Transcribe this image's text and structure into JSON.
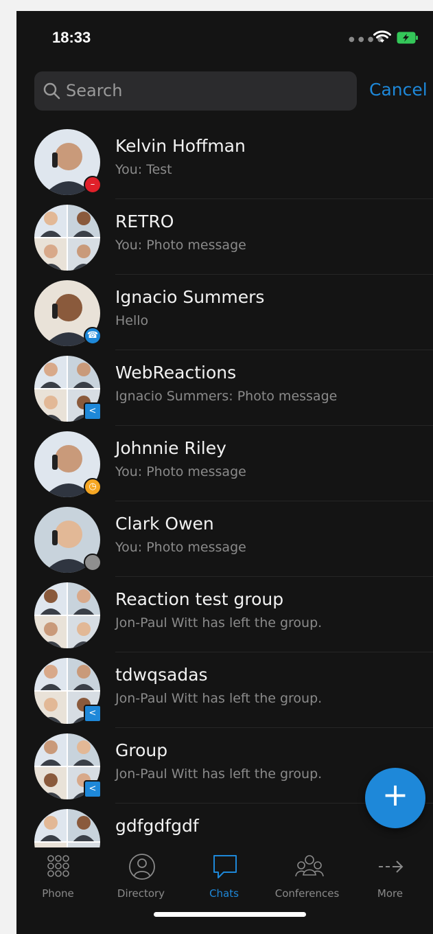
{
  "status": {
    "time": "18:33"
  },
  "search": {
    "placeholder": "Search",
    "cancel_label": "Cancel"
  },
  "colors": {
    "accent": "#1e88d9",
    "background": "#141414",
    "busy": "#e0202a",
    "away": "#f5a623",
    "offline": "#9a9a9a"
  },
  "chats": [
    {
      "name": "Kelvin Hoffman",
      "preview": "You: Test",
      "avatar": "person",
      "status": "busy"
    },
    {
      "name": "RETRO",
      "preview": "You: Photo message",
      "avatar": "group",
      "status": ""
    },
    {
      "name": "Ignacio Summers",
      "preview": "Hello",
      "avatar": "person",
      "status": "on-call"
    },
    {
      "name": "WebReactions",
      "preview": "Ignacio Summers: Photo message",
      "avatar": "group",
      "status": "shared"
    },
    {
      "name": "Johnnie Riley",
      "preview": "You: Photo message",
      "avatar": "person",
      "status": "away"
    },
    {
      "name": "Clark Owen",
      "preview": "You: Photo message",
      "avatar": "person",
      "status": "offline"
    },
    {
      "name": "Reaction test group",
      "preview": "Jon-Paul Witt has left the group.",
      "avatar": "group",
      "status": ""
    },
    {
      "name": "tdwqsadas",
      "preview": "Jon-Paul Witt has left the group.",
      "avatar": "group",
      "status": "shared"
    },
    {
      "name": "Group",
      "preview": "Jon-Paul Witt has left the group.",
      "avatar": "group",
      "status": "shared"
    },
    {
      "name": "gdfgdfgdf",
      "preview": "",
      "avatar": "group",
      "status": ""
    }
  ],
  "fab": {
    "icon": "plus-icon",
    "label": "+"
  },
  "tabs": [
    {
      "label": "Phone",
      "icon": "dialpad-icon",
      "active": false
    },
    {
      "label": "Directory",
      "icon": "contact-icon",
      "active": false
    },
    {
      "label": "Chats",
      "icon": "chat-bubble-icon",
      "active": true
    },
    {
      "label": "Conferences",
      "icon": "people-icon",
      "active": false
    },
    {
      "label": "More",
      "icon": "arrow-right-icon",
      "active": false
    }
  ]
}
